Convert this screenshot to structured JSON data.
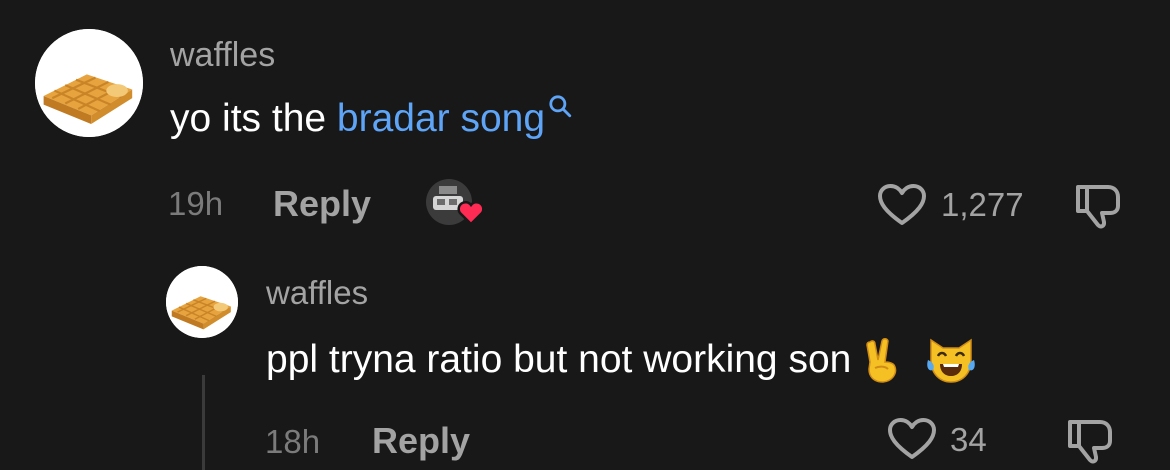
{
  "comments": [
    {
      "username": "waffles",
      "text_prefix": "yo its the ",
      "link_text": "bradar song",
      "time": "19h",
      "reply_label": "Reply",
      "likes": "1,277"
    },
    {
      "username": "waffles",
      "text": "ppl tryna ratio but not working son",
      "emojis": [
        "victory-hand",
        "cat-tears-of-joy"
      ],
      "time": "18h",
      "reply_label": "Reply",
      "likes": "34"
    }
  ],
  "icons": {
    "like": "heart-outline-icon",
    "dislike": "thumbs-down-icon",
    "search": "search-icon",
    "creator_like": "creator-liked-icon"
  },
  "colors": {
    "background": "#181818",
    "text": "#ffffff",
    "muted": "#a3a3a3",
    "link": "#5ea4f7",
    "heart": "#fe2c55"
  }
}
